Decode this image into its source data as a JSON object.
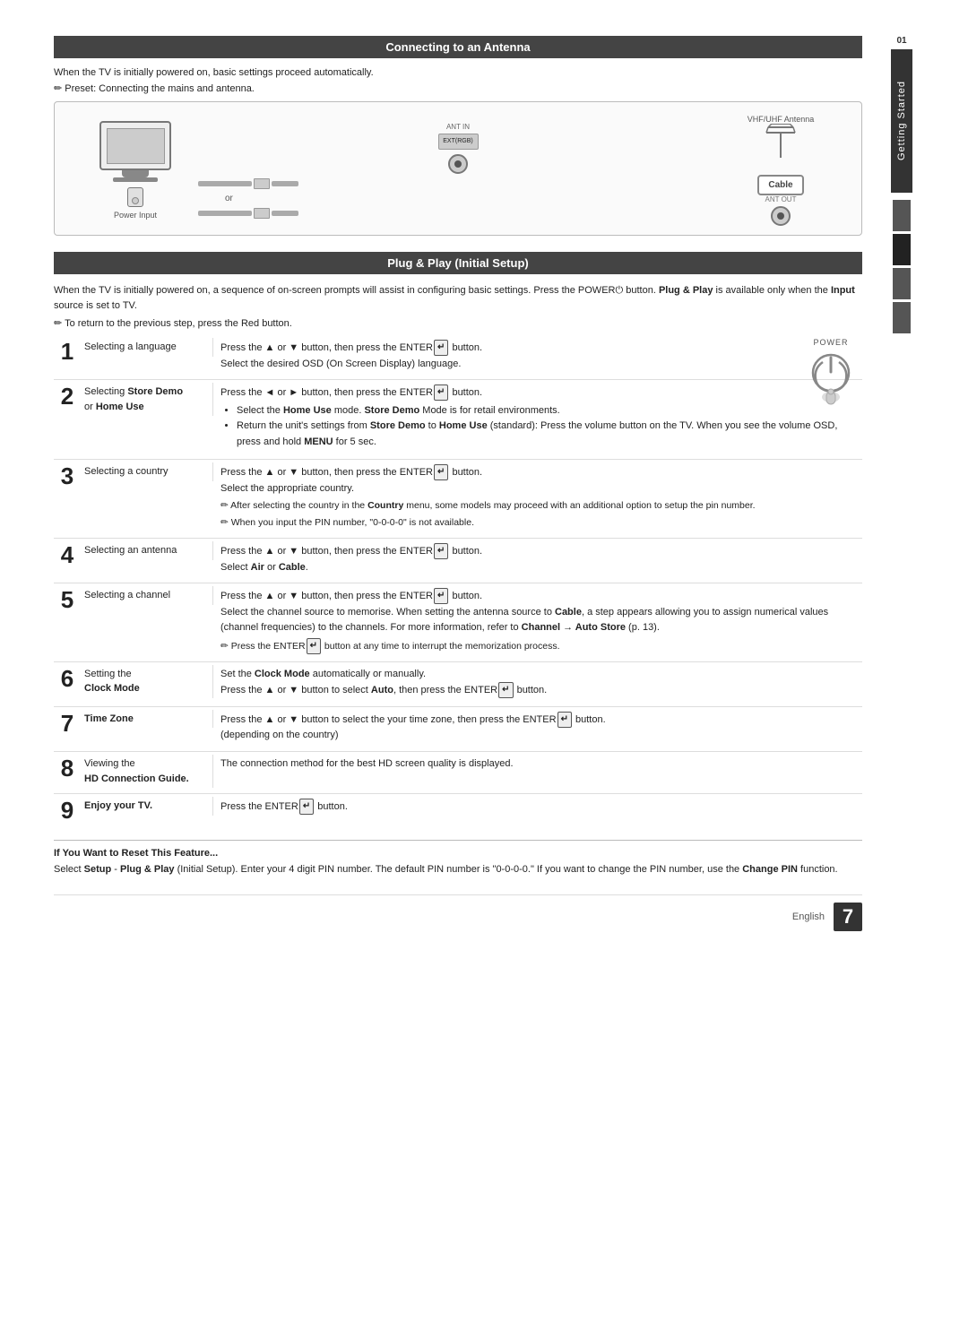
{
  "page": {
    "side_tab_number": "01",
    "side_tab_label": "Getting Started",
    "footer_lang": "English",
    "footer_page": "7"
  },
  "antenna_section": {
    "header": "Connecting to an Antenna",
    "intro": "When the TV is initially powered on, basic settings proceed automatically.",
    "preset_note": "Preset: Connecting the mains and antenna.",
    "vhf_label": "VHF/UHF Antenna",
    "cable_label": "Cable",
    "ant_out_label": "ANT OUT",
    "ant_in_label": "ANT IN",
    "ext_label": "EXT(RGB)",
    "or_label": "or",
    "power_input_label": "Power Input"
  },
  "plug_section": {
    "header": "Plug & Play (Initial Setup)",
    "intro": "When the TV is initially powered on, a sequence of on-screen prompts will assist in configuring basic settings. Press the POWER  button. Plug & Play is available only when the Input source is set to TV.",
    "note": "To return to the previous step, press the Red button.",
    "power_label": "POWER"
  },
  "steps": [
    {
      "num": "1",
      "label": "Selecting a language",
      "content": "Press the ▲ or ▼ button, then press the ENTER  button.\nSelect the desired OSD (On Screen Display) language."
    },
    {
      "num": "2",
      "label_plain": "Selecting ",
      "label_bold": "Store Demo",
      "label_plain2": " or ",
      "label_bold2": "Home Use",
      "content_bullets": [
        "Select the Home Use mode. Store Demo Mode is for retail environments.",
        "Return the unit's settings from Store Demo to Home Use (standard): Press the volume button on the TV. When you see the volume OSD, press and hold MENU for 5 sec."
      ],
      "content_intro": "Press the ◄ or ► button, then press the ENTER  button."
    },
    {
      "num": "3",
      "label": "Selecting a country",
      "content_intro": "Press the ▲ or ▼ button, then press the ENTER  button.",
      "content_line": "Select the appropriate country.",
      "notes": [
        "After selecting the country in the Country menu, some models may proceed with an additional option to setup the pin number.",
        "When you input the PIN number, \"0-0-0-0\" is not available."
      ]
    },
    {
      "num": "4",
      "label": "Selecting an antenna",
      "content_intro": "Press the ▲ or ▼ button, then press the ENTER  button.",
      "content_line": "Select Air or Cable."
    },
    {
      "num": "5",
      "label": "Selecting a channel",
      "content_intro": "Press the ▲ or ▼ button, then press the ENTER  button.",
      "content_line": "Select the channel source to memorise. When setting the antenna source to Cable, a step appears allowing you to assign numerical values (channel frequencies) to the channels. For more information, refer to Channel → Auto Store (p. 13).",
      "note": "Press the ENTER  button at any time to interrupt the memorization process."
    },
    {
      "num": "6",
      "label_plain": "Setting the ",
      "label_bold": "Clock Mode",
      "content_auto": "Set the Clock Mode automatically or manually.",
      "content_line": "Press the ▲ or ▼ button to select Auto, then press the ENTER  button."
    },
    {
      "num": "7",
      "label_bold": "Time Zone",
      "content": "Press the ▲ or ▼ button to select the your time zone, then press the ENTER  button. (depending on the country)"
    },
    {
      "num": "8",
      "label_plain": "Viewing the ",
      "label_bold": "HD Connection Guide.",
      "content": "The connection method for the best HD screen quality is displayed."
    },
    {
      "num": "9",
      "label_bold": "Enjoy your TV.",
      "content": "Press the ENTER  button."
    }
  ],
  "reset_section": {
    "title": "If You Want to Reset This Feature...",
    "text": "Select Setup - Plug & Play (Initial Setup). Enter your 4 digit PIN number. The default PIN number is \"0-0-0-0.\" If you want to change the PIN number, use the Change PIN function."
  }
}
